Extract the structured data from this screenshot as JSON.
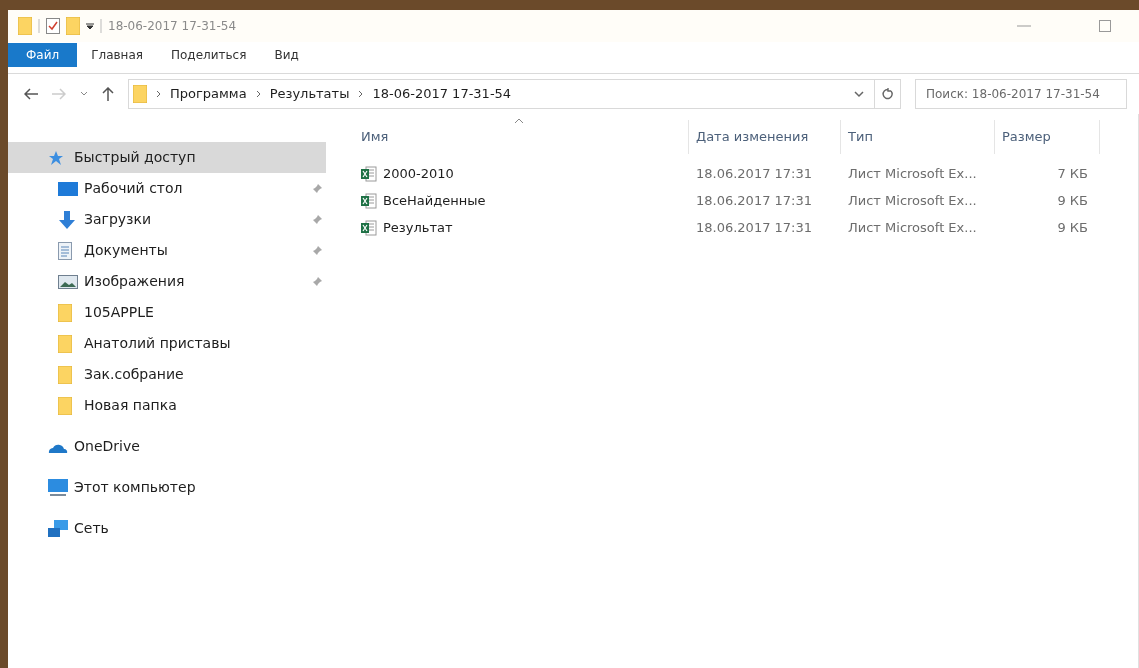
{
  "window": {
    "title": "18-06-2017 17-31-54"
  },
  "ribbon_tabs": [
    {
      "label": "Файл",
      "selected": true
    },
    {
      "label": "Главная",
      "selected": false
    },
    {
      "label": "Поделиться",
      "selected": false
    },
    {
      "label": "Вид",
      "selected": false
    }
  ],
  "address_bar": {
    "path": [
      "Программа",
      "Результаты",
      "18-06-2017 17-31-54"
    ]
  },
  "search": {
    "placeholder": "Поиск: 18-06-2017 17-31-54"
  },
  "sidebar": {
    "items": [
      {
        "label": "Быстрый доступ",
        "kind": "star",
        "selected": true,
        "children": [
          {
            "label": "Рабочий стол",
            "kind": "desktop",
            "pinned": true,
            "selected": false
          },
          {
            "label": "Загрузки",
            "kind": "download",
            "pinned": true,
            "selected": false
          },
          {
            "label": "Документы",
            "kind": "document",
            "pinned": true,
            "selected": false
          },
          {
            "label": "Изображения",
            "kind": "image",
            "pinned": true,
            "selected": false
          },
          {
            "label": "105APPLE",
            "kind": "folder",
            "pinned": false,
            "selected": false
          },
          {
            "label": "Анатолий приставы",
            "kind": "folder",
            "pinned": false,
            "selected": false
          },
          {
            "label": "Зак.собрание",
            "kind": "folder",
            "pinned": false,
            "selected": false
          },
          {
            "label": "Новая папка",
            "kind": "folder",
            "pinned": false,
            "selected": false
          }
        ]
      },
      {
        "label": "OneDrive",
        "kind": "cloud",
        "selected": false
      },
      {
        "label": "Этот компьютер",
        "kind": "computer",
        "selected": false
      },
      {
        "label": "Сеть",
        "kind": "network",
        "selected": false
      }
    ]
  },
  "table": {
    "columns": [
      "Имя",
      "Дата изменения",
      "Тип",
      "Размер"
    ],
    "rows": [
      [
        "2000-2010",
        "18.06.2017 17:31",
        "Лист Microsoft Ex...",
        "7 КБ"
      ],
      [
        "ВсеНайденные",
        "18.06.2017 17:31",
        "Лист Microsoft Ex...",
        "9 КБ"
      ],
      [
        "Результат",
        "18.06.2017 17:31",
        "Лист Microsoft Ex...",
        "9 КБ"
      ]
    ]
  }
}
